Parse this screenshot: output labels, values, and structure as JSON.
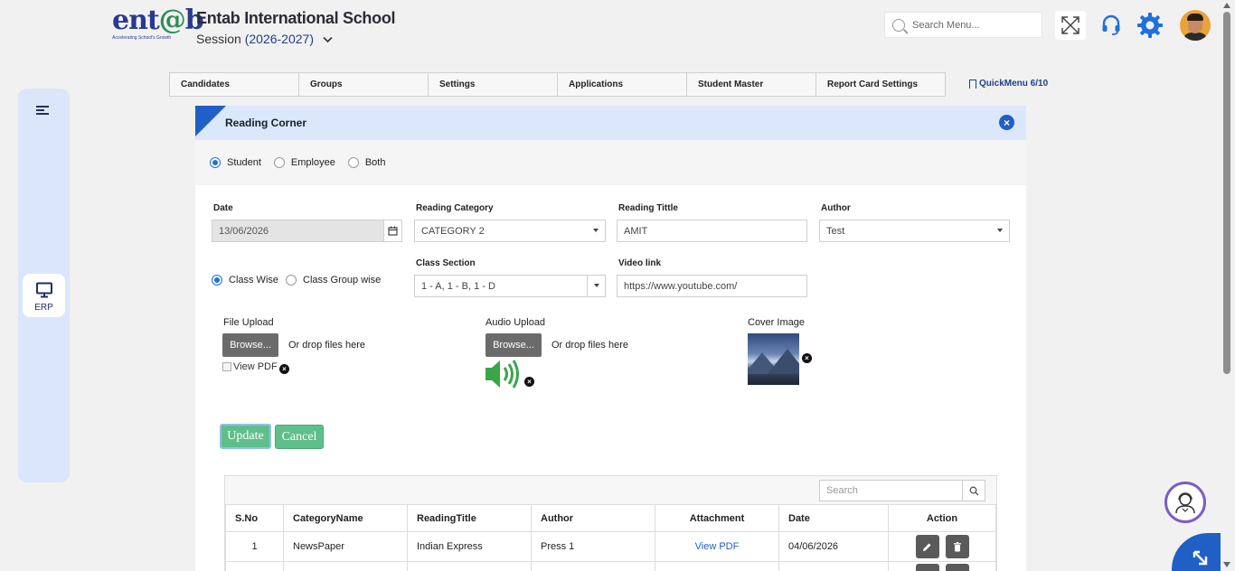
{
  "header": {
    "logo_text": "entab",
    "logo_tagline": "Accelerating School's Growth",
    "school_name": "Entab International School",
    "session_label": "Session",
    "session_value": "(2026-2027)",
    "search_placeholder": "Search Menu...",
    "icons": [
      "search-icon",
      "expand-icon",
      "headset-icon",
      "gear-icon",
      "avatar"
    ]
  },
  "sidebar": {
    "erp_label": "ERP"
  },
  "tabs": [
    "Candidates",
    "Groups",
    "Settings",
    "Applications",
    "Student Master",
    "Report Card Settings"
  ],
  "quickmenu": "QuickMenu 6/10",
  "panel": {
    "title": "Reading Corner",
    "audience": [
      {
        "label": "Student",
        "selected": true
      },
      {
        "label": "Employee",
        "selected": false
      },
      {
        "label": "Both",
        "selected": false
      }
    ],
    "form": {
      "date_label": "Date",
      "date_value": "13/06/2026",
      "category_label": "Reading Category",
      "category_value": "CATEGORY 2",
      "title_label": "Reading Tittle",
      "title_value": "AMIT",
      "author_label": "Author",
      "author_value": "Test",
      "scope": [
        {
          "label": "Class Wise",
          "selected": true
        },
        {
          "label": "Class Group wise",
          "selected": false
        }
      ],
      "class_section_label": "Class Section",
      "class_section_value": "1 - A, 1 - B, 1 - D",
      "video_label": "Video link",
      "video_value": "https://www.youtube.com/",
      "file_upload_label": "File Upload",
      "audio_upload_label": "Audio Upload",
      "cover_image_label": "Cover Image",
      "browse_label": "Browse...",
      "drop_text": "Or drop files here",
      "view_pdf_alt": "View PDF"
    },
    "buttons": {
      "update": "Update",
      "cancel": "Cancel"
    },
    "grid": {
      "search_placeholder": "Search",
      "columns": [
        "S.No",
        "CategoryName",
        "ReadingTitle",
        "Author",
        "Attachment",
        "Date",
        "Action"
      ],
      "rows": [
        [
          "1",
          "NewsPaper",
          "Indian Express",
          "Press 1",
          "View PDF",
          "04/06/2026"
        ],
        [
          "",
          "",
          "",
          "",
          "",
          ""
        ]
      ]
    }
  },
  "colors": {
    "brand_blue": "#1f5fc6",
    "button_green": "#5fbf8a",
    "sidebar_bg": "#dbe6fa"
  }
}
